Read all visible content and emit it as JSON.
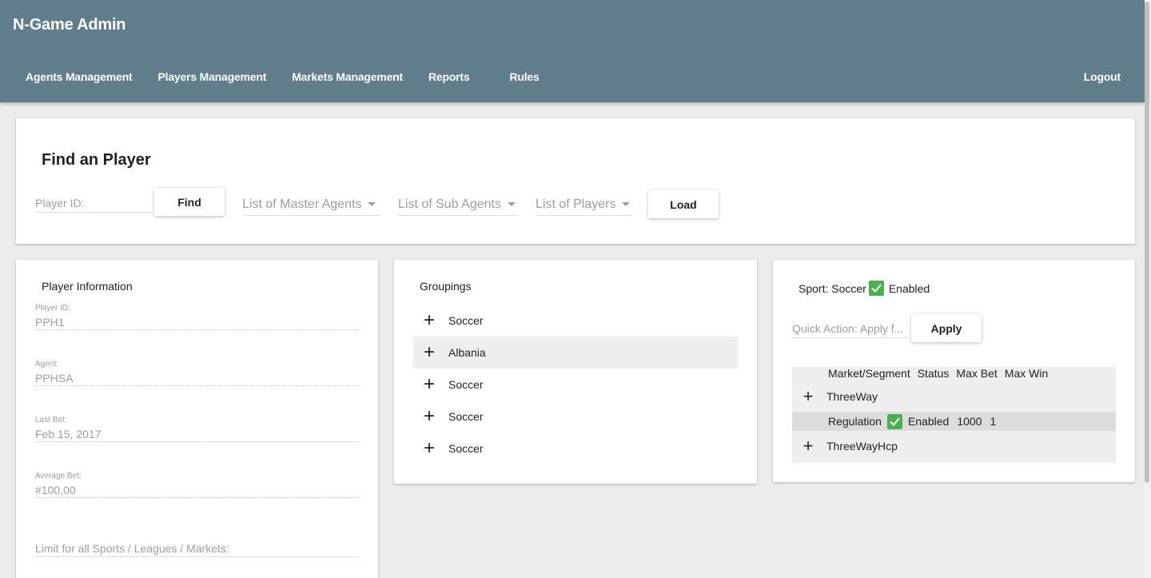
{
  "app": {
    "title": "N-Game Admin"
  },
  "nav": {
    "items": [
      "Agents Management",
      "Players Management",
      "Markets Management",
      "Reports",
      "Rules"
    ],
    "logout": "Logout"
  },
  "find": {
    "title": "Find an Player",
    "player_id_placeholder": "Player ID:",
    "find_label": "Find",
    "master_agents_placeholder": "List of Master Agents",
    "sub_agents_placeholder": "List of Sub Agents",
    "players_placeholder": "List of Players",
    "load_label": "Load"
  },
  "player_info": {
    "header": "Player Information",
    "fields": [
      {
        "label": "Player ID:",
        "value": "PPH1"
      },
      {
        "label": "Agent:",
        "value": "PPHSA"
      },
      {
        "label": "Last Bet:",
        "value": "Feb 15, 2017"
      },
      {
        "label": "Average Bet:",
        "value": "#100,00"
      }
    ],
    "limit_placeholder": "Limit for all Sports / Leagues / Markets:"
  },
  "groupings": {
    "header": "Groupings",
    "items": [
      {
        "label": "Soccer",
        "selected": false
      },
      {
        "label": "Albania",
        "selected": true
      },
      {
        "label": "Soccer",
        "selected": false
      },
      {
        "label": "Soccer",
        "selected": false
      },
      {
        "label": "Soccer",
        "selected": false
      }
    ]
  },
  "sport": {
    "label": "Sport: Soccer",
    "status": "Enabled",
    "quick_action_placeholder": "Quick Action: Apply f...",
    "apply_label": "Apply",
    "table": {
      "headers": [
        "Market/Segment",
        "Status",
        "Max Bet",
        "Max Win"
      ],
      "markets": [
        "ThreeWay",
        "ThreeWayHcp"
      ],
      "segment": {
        "name": "Regulation",
        "status": "Enabled",
        "max_bet": "1000",
        "max_win": "1"
      }
    }
  },
  "colors": {
    "appbar": "#607d8b",
    "check": "#4caf50",
    "selected_row": "#eeeeee"
  }
}
